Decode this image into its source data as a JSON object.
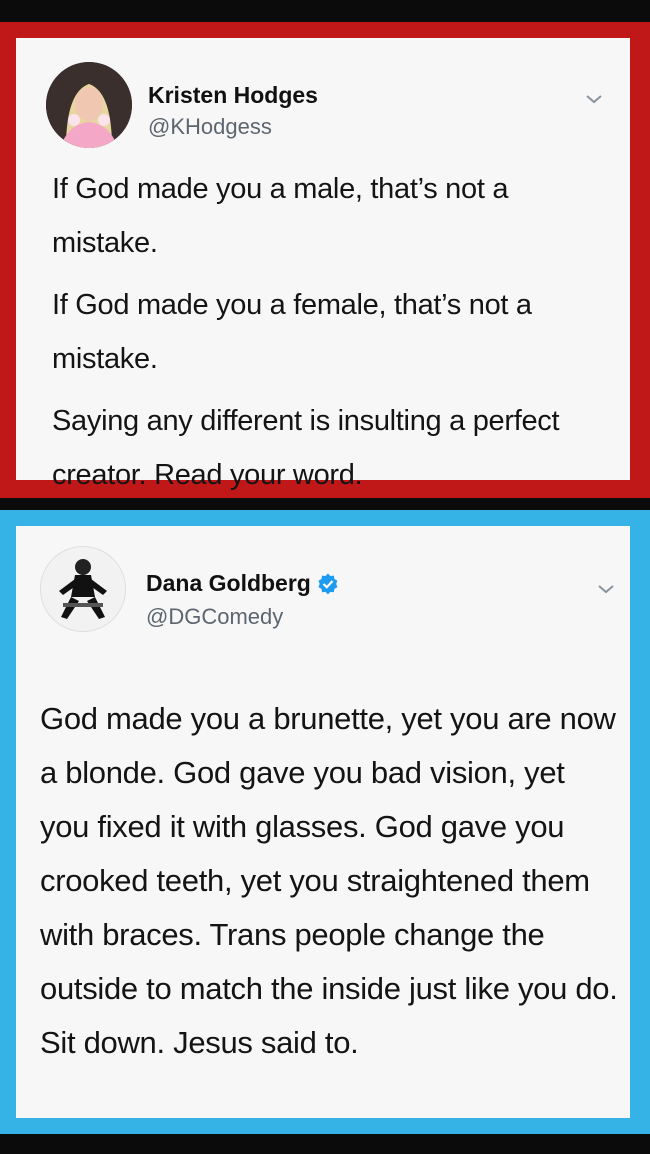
{
  "tweets": [
    {
      "name": "Kristen Hodges",
      "handle": "@KHodgess",
      "paragraphs": [
        "If God made you a male, that’s not a mistake.",
        "If God made you a female, that’s not a mistake.",
        "Saying any different is insulting a perfect creator. Read your word."
      ],
      "frame_color": "#c01818"
    },
    {
      "name": "Dana Goldberg",
      "handle": "@DGComedy",
      "verified": true,
      "text": "God made you a brunette, yet you are now a blonde. God gave you bad vision, yet you fixed it with glasses. God gave you crooked teeth, yet you straightened them with braces. Trans people change the outside to match the inside just like you do. Sit down. Jesus said to.",
      "frame_color": "#35b3e6"
    }
  ],
  "icons": {
    "menu": "chevron-down-icon",
    "verified": "verified-badge-icon"
  }
}
